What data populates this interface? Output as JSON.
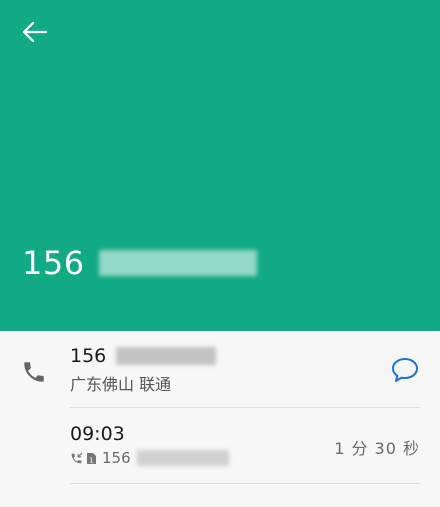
{
  "header": {
    "background_color": "#12a985",
    "back_icon": "arrow-left-icon",
    "phone_number": "156"
  },
  "contact": {
    "phone_icon": "phone-icon",
    "number": "156",
    "location": "广东佛山 联通",
    "message_icon": "message-bubble-icon"
  },
  "call_log": {
    "time": "09:03",
    "call_type_icon": "incoming-call-icon",
    "sim_icon": "sim-1-icon",
    "number": "156",
    "duration": "1 分 30 秒"
  },
  "accent_color": "#1a73d9"
}
